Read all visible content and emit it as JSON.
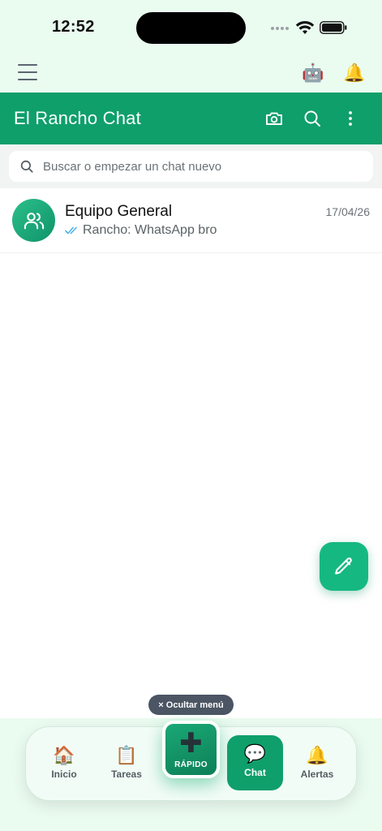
{
  "status_bar": {
    "time": "12:52"
  },
  "app_bar": {
    "menu_icon": "hamburger-icon",
    "robot_icon": "robot-icon",
    "robot_glyph": "🤖",
    "bell_icon": "bell-icon",
    "bell_glyph": "🔔"
  },
  "header": {
    "title": "El Rancho Chat",
    "icons": [
      "camera-icon",
      "search-icon",
      "more-vertical-icon"
    ]
  },
  "search": {
    "placeholder": "Buscar o empezar un chat nuevo"
  },
  "chats": [
    {
      "name": "Equipo General",
      "date": "17/04/26",
      "preview": "Rancho: WhatsApp bro",
      "avatar_icon": "group-users-icon",
      "status_icon": "double-check-icon"
    }
  ],
  "fab": {
    "icon": "pencil-icon"
  },
  "hide_menu": {
    "label": "× Ocultar menú"
  },
  "bottom_nav": {
    "items": [
      {
        "label": "Inicio",
        "glyph": "🏠",
        "icon": "home-icon"
      },
      {
        "label": "Tareas",
        "glyph": "📋",
        "icon": "clipboard-icon"
      },
      {
        "label": "RÁPIDO",
        "glyph": "✚",
        "icon": "plus-icon"
      },
      {
        "label": "Chat",
        "glyph": "💬",
        "icon": "chat-bubble-icon"
      },
      {
        "label": "Alertas",
        "glyph": "🔔",
        "icon": "bell-icon"
      }
    ],
    "active": "Chat"
  },
  "colors": {
    "primary": "#0f9f6b",
    "fab": "#16b882",
    "background": "#eafbf0",
    "read_ticks": "#4fb3e8"
  }
}
